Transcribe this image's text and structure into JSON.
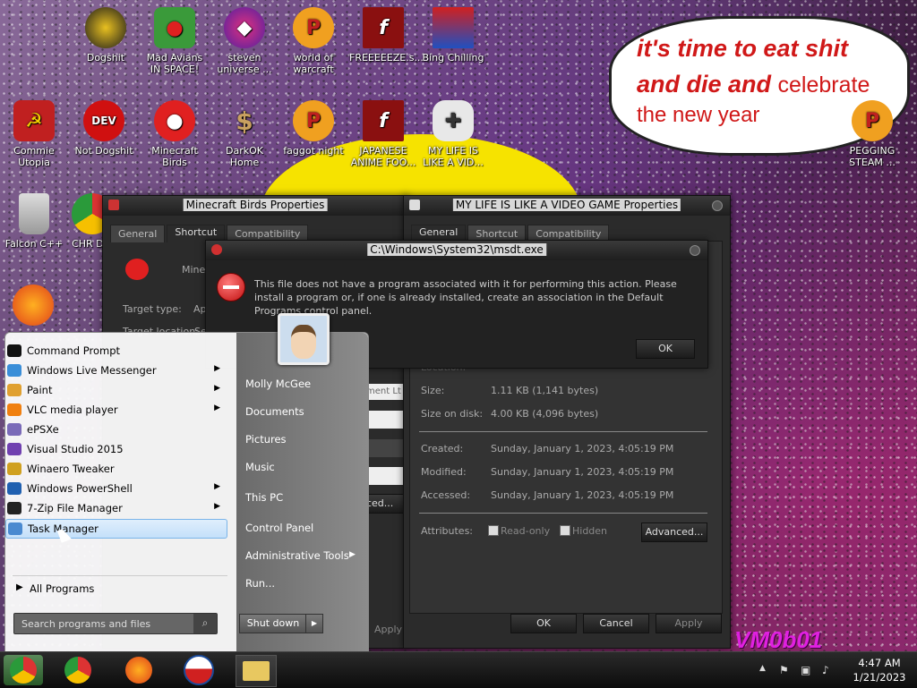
{
  "banner": {
    "line1": "it's time to eat shit",
    "line2a": "and die and ",
    "line2b": "celebrate",
    "line3": "the new year"
  },
  "watermark": "VM0b01",
  "desktop_icons": [
    {
      "label": "Dogshit",
      "icon": "dogshit-icon"
    },
    {
      "label": "Mad Avians IN SPACE!",
      "icon": "angry-bird-space-icon"
    },
    {
      "label": "steven universe ...",
      "icon": "diamond-icon"
    },
    {
      "label": "world of warcraft",
      "icon": "p-badge-icon"
    },
    {
      "label": "FREEEEEZE.s...",
      "icon": "flash-icon"
    },
    {
      "label": "Bing Chilling",
      "icon": "bing-icon"
    },
    {
      "label": "Commie Utopia",
      "icon": "hammer-sickle-icon"
    },
    {
      "label": "Not Dogshit",
      "icon": "devcpp-icon"
    },
    {
      "label": "Minecraft Birds",
      "icon": "angry-bird-icon"
    },
    {
      "label": "DarkOK Home",
      "icon": "money-bag-icon"
    },
    {
      "label": "faggot night",
      "icon": "p-badge-icon"
    },
    {
      "label": "JAPANESE ANIME FOO...",
      "icon": "flash-icon"
    },
    {
      "label": "MY LIFE IS LIKE A VID...",
      "icon": "gamepad-icon"
    },
    {
      "label": "PEGGING STEAM ...",
      "icon": "p-badge-icon"
    },
    {
      "label": "Falcon C++",
      "icon": "recycle-bin-icon"
    },
    {
      "label": "CHR DIS",
      "icon": "chrome-icon"
    }
  ],
  "win_minecraft": {
    "title": "Minecraft Birds Properties",
    "tabs": [
      "General",
      "Shortcut",
      "Compatibility"
    ],
    "name": "Minec",
    "target_type": "Target type:",
    "target_type_val": "Ap",
    "target_location": "Target location:",
    "target_location_val": "Se",
    "frag1": "ment Lt",
    "frag2": "nced...",
    "apply": "Apply"
  },
  "win_mylife": {
    "title": "MY LIFE IS LIKE A VIDEO GAME Properties",
    "tabs": [
      "General",
      "Shortcut",
      "Compatibility"
    ],
    "location_frag": "Location:",
    "size_label": "Size:",
    "size_val": "1.11 KB (1,141 bytes)",
    "sod_label": "Size on disk:",
    "sod_val": "4.00 KB (4,096 bytes)",
    "created_label": "Created:",
    "created_val": "Sunday, January 1, 2023, 4:05:19 PM",
    "modified_label": "Modified:",
    "modified_val": "Sunday, January 1, 2023, 4:05:19 PM",
    "accessed_label": "Accessed:",
    "accessed_val": "Sunday, January 1, 2023, 4:05:19 PM",
    "attributes_label": "Attributes:",
    "readonly": "Read-only",
    "hidden": "Hidden",
    "advanced": "Advanced...",
    "ok": "OK",
    "cancel": "Cancel",
    "apply": "Apply"
  },
  "error_dialog": {
    "title": "C:\\Windows\\System32\\msdt.exe",
    "message": "This file does not have a program associated with it for performing this action. Please install a program or, if one is already installed, create an association in the Default Programs control panel.",
    "ok": "OK"
  },
  "start_menu": {
    "programs": [
      {
        "label": "Command Prompt",
        "arrow": false,
        "color": "#111",
        "icon": "cmd-icon"
      },
      {
        "label": "Windows Live Messenger",
        "arrow": true,
        "color": "#3a8ed8",
        "icon": "messenger-icon"
      },
      {
        "label": "Paint",
        "arrow": true,
        "color": "#e0a030",
        "icon": "paint-icon"
      },
      {
        "label": "VLC media player",
        "arrow": true,
        "color": "#f08010",
        "icon": "vlc-icon"
      },
      {
        "label": "ePSXe",
        "arrow": false,
        "color": "#7a6ab8",
        "icon": "epsxe-icon"
      },
      {
        "label": "Visual Studio 2015",
        "arrow": false,
        "color": "#7040b0",
        "icon": "visual-studio-icon"
      },
      {
        "label": "Winaero Tweaker",
        "arrow": false,
        "color": "#d0a020",
        "icon": "winaero-icon"
      },
      {
        "label": "Windows PowerShell",
        "arrow": true,
        "color": "#2060b0",
        "icon": "powershell-icon"
      },
      {
        "label": "7-Zip File Manager",
        "arrow": true,
        "color": "#222",
        "icon": "7zip-icon"
      },
      {
        "label": "Task Manager",
        "arrow": false,
        "color": "#4a8ad0",
        "icon": "task-manager-icon",
        "highlight": true
      }
    ],
    "all_programs": "All Programs",
    "search_placeholder": "Search programs and files",
    "right": [
      "Molly McGee",
      "Documents",
      "Pictures",
      "Music",
      "This PC",
      "Control Panel",
      "Administrative Tools",
      "Run..."
    ],
    "shutdown": "Shut down"
  },
  "taskbar": {
    "apps": [
      "chrome-old-icon",
      "chrome-icon",
      "firefox-icon",
      "obama-icon",
      "file-explorer-icon"
    ],
    "time": "4:47 AM",
    "date": "1/21/2023"
  }
}
